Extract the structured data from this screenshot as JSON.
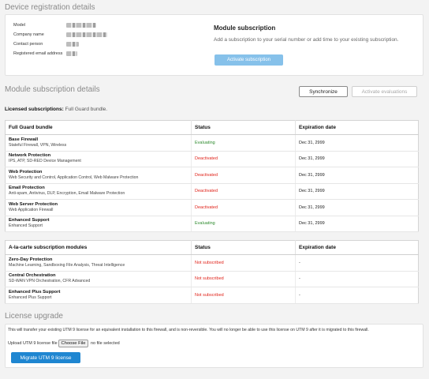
{
  "device": {
    "title": "Device registration details",
    "fields": [
      {
        "label": "Model"
      },
      {
        "label": "Company name"
      },
      {
        "label": "Contact person"
      },
      {
        "label": "Registered email address"
      }
    ],
    "module_subscription": {
      "heading": "Module subscription",
      "text": "Add a subscription to your serial number or add time to your existing subscription.",
      "button": "Activate subscription"
    }
  },
  "module_details": {
    "title": "Module subscription details",
    "sync_button": "Synchronize",
    "activate_eval_button": "Activate evaluations",
    "licensed_label": "Licensed subscriptions:",
    "licensed_value": "Full Guard bundle."
  },
  "bundle_table": {
    "headers": [
      "Full Guard bundle",
      "Status",
      "Expiration date"
    ],
    "rows": [
      {
        "name": "Base Firewall",
        "desc": "Stateful Firewall, VPN, Wireless",
        "status": "Evaluating",
        "expires": "Dec 31, 2999"
      },
      {
        "name": "Network Protection",
        "desc": "IPS, ATP, SD-RED Device Management",
        "status": "Deactivated",
        "expires": "Dec 31, 2999"
      },
      {
        "name": "Web Protection",
        "desc": "Web Security and Control, Application Control, Web Malware Protection",
        "status": "Deactivated",
        "expires": "Dec 31, 2999"
      },
      {
        "name": "Email Protection",
        "desc": "Anti-spam, Antivirus, DLP, Encryption, Email Malware Protection",
        "status": "Deactivated",
        "expires": "Dec 31, 2999"
      },
      {
        "name": "Web Server Protection",
        "desc": "Web Application Firewall",
        "status": "Deactivated",
        "expires": "Dec 31, 2999"
      },
      {
        "name": "Enhanced Support",
        "desc": "Enhanced Support",
        "status": "Evaluating",
        "expires": "Dec 31, 2999"
      }
    ]
  },
  "alacarte_table": {
    "headers": [
      "A-la-carte subscription modules",
      "Status",
      "Expiration date"
    ],
    "rows": [
      {
        "name": "Zero-Day Protection",
        "desc": "Machine Learning, Sandboxing File Analysis, Threat Intelligence",
        "status": "Not subscribed",
        "expires": "-"
      },
      {
        "name": "Central Orchestration",
        "desc": "SD-WAN VPN Orchestration, CFR Advanced",
        "status": "Not subscribed",
        "expires": "-"
      },
      {
        "name": "Enhanced Plus Support",
        "desc": "Enhanced Plus Support",
        "status": "Not subscribed",
        "expires": "-"
      }
    ]
  },
  "license_upgrade": {
    "title": "License upgrade",
    "notice": "This will transfer your existing UTM 9 license for an equivalent installation to this firewall, and is non-reversible. You will no longer be able to use this license on UTM 9 after it is migrated to this firewall.",
    "upload_label": "Upload UTM 9 license file",
    "choose_file": "Choose File",
    "no_file": "no file selected",
    "migrate_button": "Migrate UTM 9 license"
  },
  "colors": {
    "evaluating": "#2e8b2e",
    "deactivated": "#e0241b",
    "primary": "#1f86d1",
    "primary_light": "#86c1ea"
  }
}
